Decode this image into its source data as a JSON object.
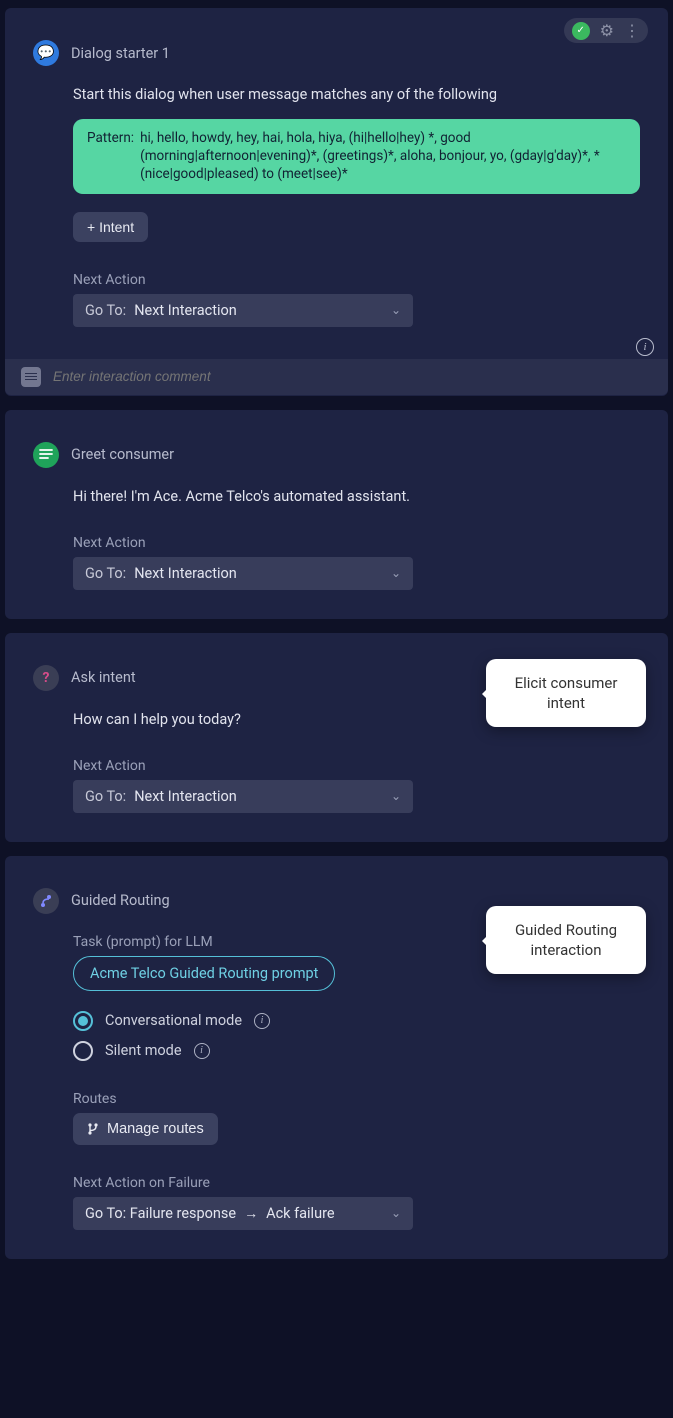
{
  "card1": {
    "title": "Dialog starter 1",
    "desc": "Start this dialog when user message matches any of the following",
    "pattern_label": "Pattern:",
    "pattern_text": "hi, hello, howdy, hey, hai, hola, hiya, (hi|hello|hey) *, good (morning|afternoon|evening)*, (greetings)*, aloha, bonjour, yo, (gday|g'day)*, *(nice|good|pleased) to (meet|see)*",
    "intent_btn": "+ Intent",
    "next_action_label": "Next Action",
    "goto_prefix": "Go To:",
    "goto_value": "Next Interaction",
    "comment_placeholder": "Enter interaction comment"
  },
  "card2": {
    "title": "Greet consumer",
    "message": "Hi there! I'm Ace. Acme Telco's automated assistant.",
    "next_action_label": "Next Action",
    "goto_prefix": "Go To:",
    "goto_value": "Next Interaction"
  },
  "card3": {
    "title": "Ask intent",
    "message": "How can I help you today?",
    "next_action_label": "Next Action",
    "goto_prefix": "Go To:",
    "goto_value": "Next Interaction",
    "callout": "Elicit consumer intent"
  },
  "card4": {
    "title": "Guided Routing",
    "task_label": "Task (prompt) for LLM",
    "task_chip": "Acme Telco Guided Routing prompt",
    "mode_conv": "Conversational mode",
    "mode_silent": "Silent mode",
    "selected_mode": "conversational",
    "routes_label": "Routes",
    "manage_btn": "Manage routes",
    "next_fail_label": "Next Action on Failure",
    "goto_fail_prefix": "Go To: Failure response",
    "goto_fail_value": "Ack failure",
    "callout": "Guided Routing interaction"
  }
}
